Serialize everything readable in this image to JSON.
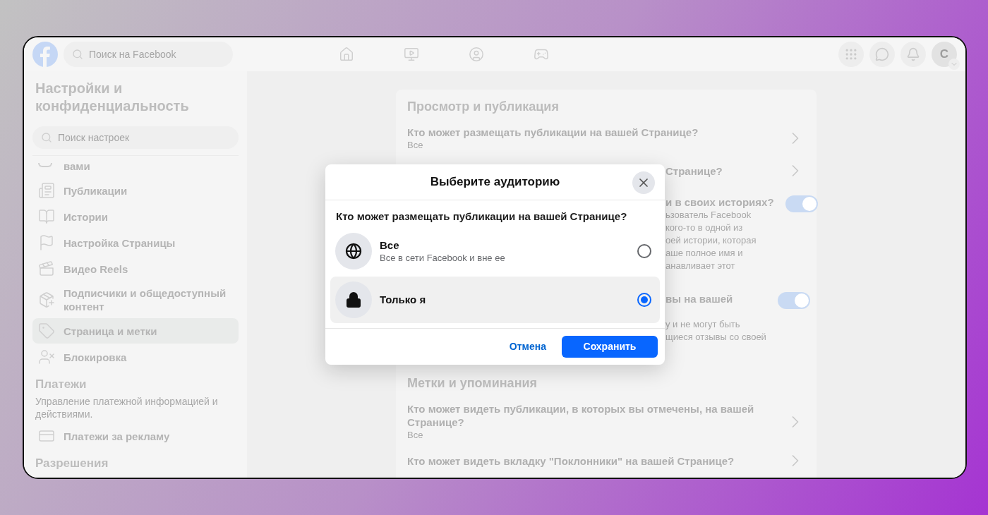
{
  "top_bar": {
    "search_placeholder": "Поиск на Facebook",
    "avatar_letter": "С"
  },
  "sidebar": {
    "title": "Настройки и конфиденциальность",
    "search_placeholder": "Поиск настроек",
    "items": [
      {
        "label": "вами",
        "selected": false
      },
      {
        "label": "Публикации",
        "selected": false
      },
      {
        "label": "Истории",
        "selected": false
      },
      {
        "label": "Настройка Страницы",
        "selected": false
      },
      {
        "label": "Видео Reels",
        "selected": false
      },
      {
        "label": "Подписчики и общедоступный контент",
        "selected": false
      },
      {
        "label": "Страница и метки",
        "selected": true
      },
      {
        "label": "Блокировка",
        "selected": false
      }
    ],
    "sections": [
      {
        "title": "Платежи",
        "description": "Управление платежной информацией и действиями.",
        "items": [
          {
            "label": "Платежи за рекламу",
            "selected": false
          }
        ]
      },
      {
        "title": "Разрешения"
      }
    ]
  },
  "main": {
    "sections": [
      {
        "title": "Просмотр и публикация",
        "rows": [
          {
            "kind": "link",
            "occluded": false,
            "label": "Кто может размещать публикации на вашей Странице?",
            "value": "Все"
          },
          {
            "kind": "link",
            "occluded": true,
            "label": "Странице?"
          },
          {
            "kind": "toggle",
            "occluded": true,
            "label": "и в своих историях?",
            "lines": [
              "ьзователь Facebook",
              "кого-то в одной из",
              "оей истории, которая",
              "аше полное имя и",
              "анавливает этот"
            ],
            "on": true
          },
          {
            "kind": "toggle",
            "occluded": true,
            "label": "вы на вашей",
            "lines": [
              "у и не могут быть",
              "щиеся отзывы со своей"
            ],
            "on": true
          }
        ]
      },
      {
        "title": "Метки и упоминания",
        "rows": [
          {
            "kind": "link",
            "occluded": false,
            "label": "Кто может видеть публикации, в которых вы отмечены, на вашей Странице?",
            "value": "Все"
          },
          {
            "kind": "link",
            "occluded": false,
            "label": "Кто может видеть вкладку \"Поклонники\" на вашей Странице?"
          }
        ]
      }
    ]
  },
  "dialog": {
    "title": "Выберите аудиторию",
    "question": "Кто может размещать публикации на вашей Странице?",
    "options": [
      {
        "label": "Все",
        "description": "Все в сети Facebook и вне ее",
        "selected": false
      },
      {
        "label": "Только я",
        "selected": true
      }
    ],
    "cancel": "Отмена",
    "save": "Сохранить"
  }
}
